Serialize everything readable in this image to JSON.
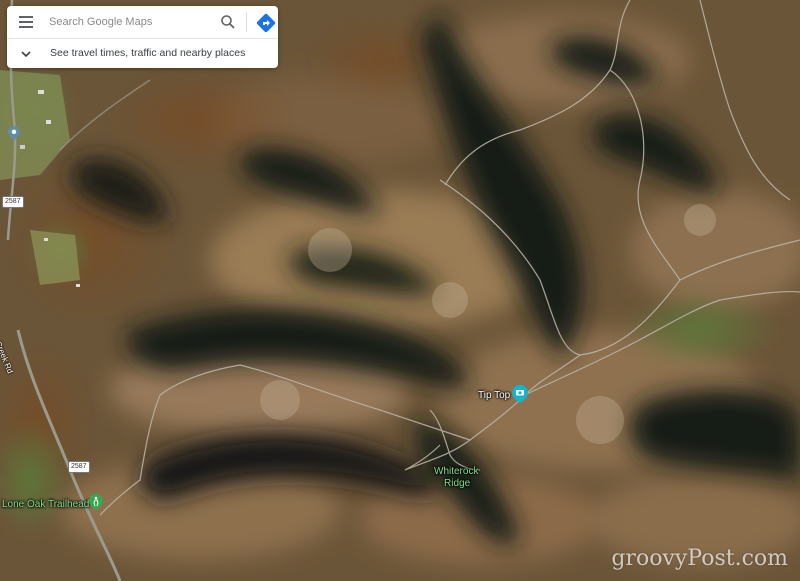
{
  "search": {
    "placeholder": "Search Google Maps",
    "travel_hint": "See travel times, traffic and nearby places"
  },
  "icons": {
    "menu": "hamburger-menu-icon",
    "search": "search-icon",
    "directions": "directions-icon",
    "expand": "chevron-down-icon"
  },
  "places": {
    "tip_top": "Tip Top",
    "whiterock_ridge_line1": "Whiterock",
    "whiterock_ridge_line2": "Ridge",
    "lone_oak_trailhead": "Lone Oak Trailhead"
  },
  "roads": {
    "route_2587_a": "2587",
    "route_2587_b": "2587",
    "creek_rd": "Creek Rd"
  },
  "colors": {
    "directions_blue": "#1a73e8",
    "poi_teal": "#12b5cb",
    "trail_green": "#34a853",
    "ridge_label_green": "#7ee08a"
  },
  "watermark": "groovyPost.com"
}
